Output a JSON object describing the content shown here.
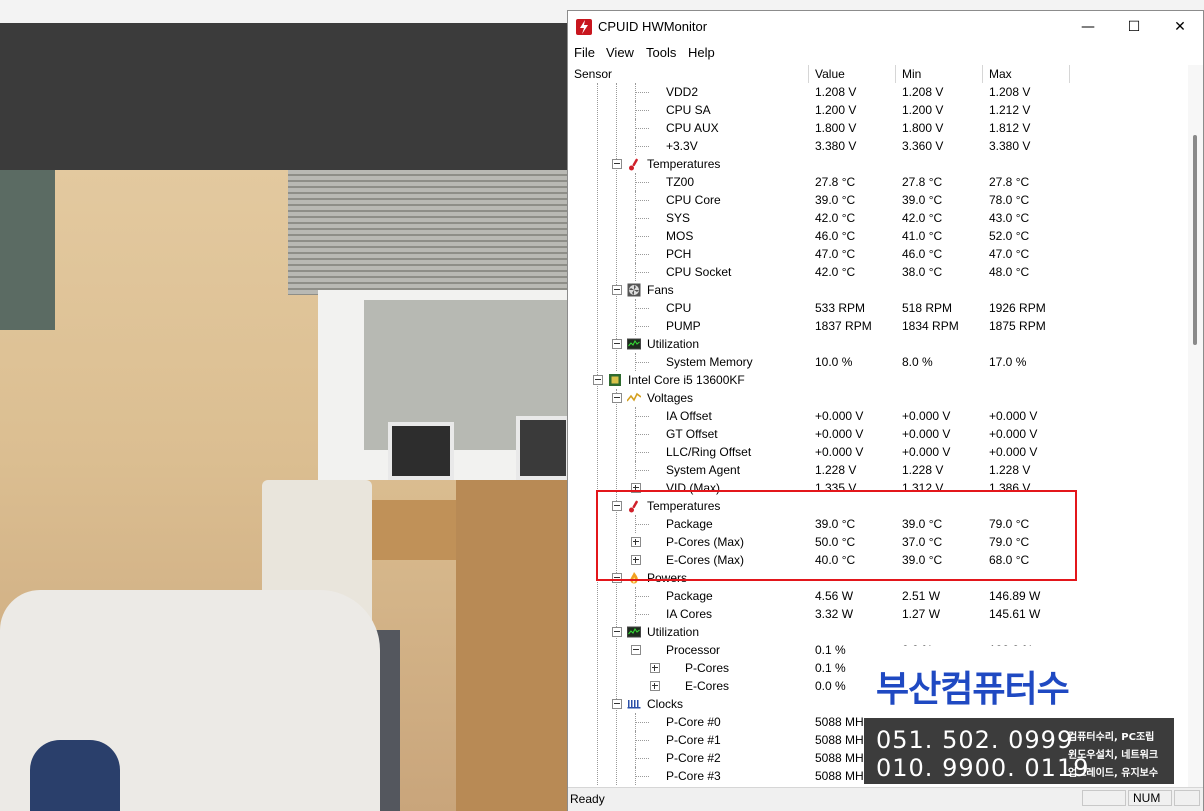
{
  "window": {
    "title": "CPUID HWMonitor",
    "controls": {
      "minimize": "—",
      "maximize": "☐",
      "close": "✕"
    }
  },
  "menu": [
    "File",
    "View",
    "Tools",
    "Help"
  ],
  "columns": [
    "Sensor",
    "Value",
    "Min",
    "Max"
  ],
  "rows": [
    {
      "label": "VDD2",
      "value": "1.208 V",
      "min": "1.208 V",
      "max": "1.208 V",
      "level": 3
    },
    {
      "label": "CPU SA",
      "value": "1.200 V",
      "min": "1.200 V",
      "max": "1.212 V",
      "level": 3
    },
    {
      "label": "CPU AUX",
      "value": "1.800 V",
      "min": "1.800 V",
      "max": "1.812 V",
      "level": 3
    },
    {
      "label": "+3.3V",
      "value": "3.380 V",
      "min": "3.360 V",
      "max": "3.380 V",
      "level": 3
    },
    {
      "label": "Temperatures",
      "level": 2,
      "icon": "thermometer-icon",
      "expander": "minus"
    },
    {
      "label": "TZ00",
      "value": "27.8 °C",
      "min": "27.8 °C",
      "max": "27.8 °C",
      "level": 3
    },
    {
      "label": "CPU Core",
      "value": "39.0 °C",
      "min": "39.0 °C",
      "max": "78.0 °C",
      "level": 3
    },
    {
      "label": "SYS",
      "value": "42.0 °C",
      "min": "42.0 °C",
      "max": "43.0 °C",
      "level": 3
    },
    {
      "label": "MOS",
      "value": "46.0 °C",
      "min": "41.0 °C",
      "max": "52.0 °C",
      "level": 3
    },
    {
      "label": "PCH",
      "value": "47.0 °C",
      "min": "46.0 °C",
      "max": "47.0 °C",
      "level": 3
    },
    {
      "label": "CPU Socket",
      "value": "42.0 °C",
      "min": "38.0 °C",
      "max": "48.0 °C",
      "level": 3
    },
    {
      "label": "Fans",
      "level": 2,
      "icon": "fan-icon",
      "expander": "minus"
    },
    {
      "label": "CPU",
      "value": "533 RPM",
      "min": "518 RPM",
      "max": "1926 RPM",
      "level": 3
    },
    {
      "label": "PUMP",
      "value": "1837 RPM",
      "min": "1834 RPM",
      "max": "1875 RPM",
      "level": 3
    },
    {
      "label": "Utilization",
      "level": 2,
      "icon": "utilization-icon",
      "expander": "minus"
    },
    {
      "label": "System Memory",
      "value": "10.0 %",
      "min": "8.0 %",
      "max": "17.0 %",
      "level": 3
    },
    {
      "label": "Intel Core i5 13600KF",
      "level": 1,
      "icon": "cpu-chip-icon",
      "expander": "minus"
    },
    {
      "label": "Voltages",
      "level": 2,
      "icon": "voltage-icon",
      "expander": "minus"
    },
    {
      "label": "IA Offset",
      "value": "+0.000 V",
      "min": "+0.000 V",
      "max": "+0.000 V",
      "level": 3
    },
    {
      "label": "GT Offset",
      "value": "+0.000 V",
      "min": "+0.000 V",
      "max": "+0.000 V",
      "level": 3
    },
    {
      "label": "LLC/Ring Offset",
      "value": "+0.000 V",
      "min": "+0.000 V",
      "max": "+0.000 V",
      "level": 3
    },
    {
      "label": "System Agent",
      "value": "1.228 V",
      "min": "1.228 V",
      "max": "1.228 V",
      "level": 3
    },
    {
      "label": "VID (Max)",
      "value": "1.335 V",
      "min": "1.312 V",
      "max": "1.386 V",
      "level": 3,
      "expander": "plus"
    },
    {
      "label": "Temperatures",
      "level": 2,
      "icon": "thermometer-icon",
      "expander": "minus"
    },
    {
      "label": "Package",
      "value": "39.0 °C",
      "min": "39.0 °C",
      "max": "79.0 °C",
      "level": 3
    },
    {
      "label": "P-Cores (Max)",
      "value": "50.0 °C",
      "min": "37.0 °C",
      "max": "79.0 °C",
      "level": 3,
      "expander": "plus"
    },
    {
      "label": "E-Cores (Max)",
      "value": "40.0 °C",
      "min": "39.0 °C",
      "max": "68.0 °C",
      "level": 3,
      "expander": "plus"
    },
    {
      "label": "Powers",
      "level": 2,
      "icon": "power-icon",
      "expander": "minus"
    },
    {
      "label": "Package",
      "value": "4.56 W",
      "min": "2.51 W",
      "max": "146.89 W",
      "level": 3
    },
    {
      "label": "IA Cores",
      "value": "3.32 W",
      "min": "1.27 W",
      "max": "145.61 W",
      "level": 3
    },
    {
      "label": "Utilization",
      "level": 2,
      "icon": "utilization-icon",
      "expander": "minus"
    },
    {
      "label": "Processor",
      "value": "0.1 %",
      "min": "0.0 %",
      "max": "100.0 %",
      "level": 3,
      "expander": "minus"
    },
    {
      "label": "P-Cores",
      "value": "0.1 %",
      "min": "",
      "max": "",
      "level": 4,
      "expander": "plus"
    },
    {
      "label": "E-Cores",
      "value": "0.0 %",
      "min": "",
      "max": "",
      "level": 4,
      "expander": "plus"
    },
    {
      "label": "Clocks",
      "level": 2,
      "icon": "clock-icon",
      "expander": "minus"
    },
    {
      "label": "P-Core #0",
      "value": "5088 MHz",
      "min": "",
      "max": "",
      "level": 3
    },
    {
      "label": "P-Core #1",
      "value": "5088 MHz",
      "min": "",
      "max": "",
      "level": 3
    },
    {
      "label": "P-Core #2",
      "value": "5088 MHz",
      "min": "",
      "max": "",
      "level": 3
    },
    {
      "label": "P-Core #3",
      "value": "5088 MHz",
      "min": "",
      "max": "",
      "level": 3
    }
  ],
  "status": {
    "text": "Ready",
    "num": "NUM"
  },
  "ad": {
    "site": "부산컴퓨터수리.com",
    "phones": [
      "051. 502. 0999",
      "010. 9900. 0119"
    ],
    "services": [
      "컴퓨터수리, PC조립",
      "윈도우설치, 네트워크",
      "업그레이드, 유지보수"
    ]
  },
  "colors": {
    "highlight": "#e3161b",
    "ad_text": "#1f49c2",
    "ad_dark": "#3c3c3c",
    "icon_red": "#c8161e"
  }
}
